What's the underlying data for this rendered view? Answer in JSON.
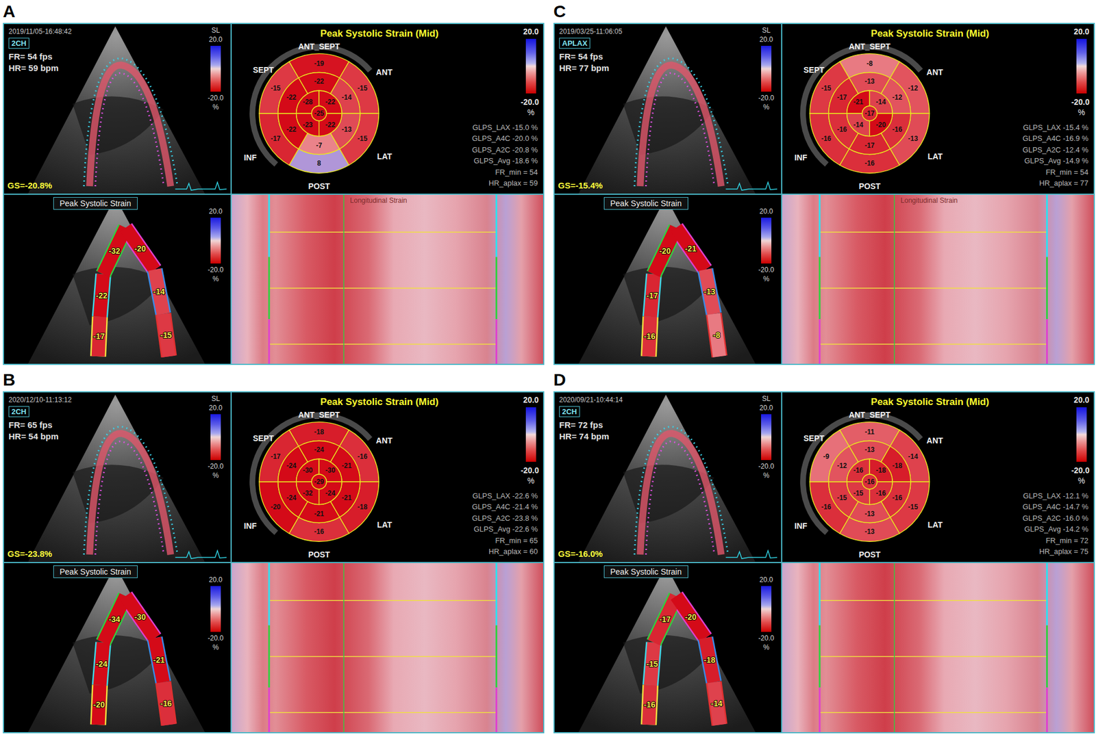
{
  "panels": [
    {
      "letter": "A",
      "echo": {
        "timestamp": "2019/11/05-16:48:42",
        "view": "2CH",
        "fr": "FR= 54 fps",
        "hr": "HR= 59 bpm",
        "scale_label": "SL",
        "scale_max": "20.0",
        "scale_min": "-20.0",
        "scale_unit": "%",
        "gs": "GS=-20.8%"
      },
      "bullseye": {
        "title": "Peak Systolic Strain (Mid)",
        "labels": {
          "ant_sept": "ANT_SEPT",
          "sept": "SEPT",
          "ant": "ANT",
          "inf": "INF",
          "lat": "LAT",
          "post": "POST"
        },
        "basal": [
          "-19",
          "-15",
          "-15",
          "8",
          "-17",
          "-15"
        ],
        "mid": [
          "-22",
          "-14",
          "-13",
          "-7",
          "-22",
          "-22"
        ],
        "apical": [
          "-28",
          "-22",
          "-22",
          "-23"
        ],
        "apex": "-25",
        "scale_max": "20.0",
        "scale_min": "-20.0",
        "scale_unit": "%",
        "stats": [
          "GLPS_LAX -15.0 %",
          "GLPS_A4C -20.0 %",
          "GLPS_A2C -20.8 %",
          "GLPS_Avg -18.6 %",
          "FR_min = 54",
          "HR_aplax = 59"
        ]
      },
      "segments": {
        "label": "Peak Systolic Strain",
        "scale_max": "20.0",
        "scale_min": "-20.0",
        "scale_unit": "%",
        "values": [
          "-17",
          "-22",
          "-32",
          "-20",
          "-14",
          "-15"
        ]
      },
      "heatmap": {
        "title": "Longitudinal Strain"
      }
    },
    {
      "letter": "C",
      "echo": {
        "timestamp": "2019/03/25-11:06:05",
        "view": "APLAX",
        "fr": "FR= 54 fps",
        "hr": "HR= 77 bpm",
        "scale_label": "SL",
        "scale_max": "20.0",
        "scale_min": "-20.0",
        "scale_unit": "%",
        "gs": "GS=-15.4%"
      },
      "bullseye": {
        "title": "Peak Systolic Strain (Mid)",
        "labels": {
          "ant_sept": "ANT_SEPT",
          "sept": "SEPT",
          "ant": "ANT",
          "inf": "INF",
          "lat": "LAT",
          "post": "POST"
        },
        "basal": [
          "-8",
          "-12",
          "-13",
          "-16",
          "-16",
          "-15"
        ],
        "mid": [
          "-13",
          "-12",
          "-16",
          "-17",
          "-16",
          "-17"
        ],
        "apical": [
          "-21",
          "-14",
          "-20",
          "-14"
        ],
        "apex": "-17",
        "scale_max": "20.0",
        "scale_min": "-20.0",
        "scale_unit": "%",
        "stats": [
          "GLPS_LAX -15.4 %",
          "GLPS_A4C -16.9 %",
          "GLPS_A2C -12.4 %",
          "GLPS_Avg -14.9 %",
          "FR_min = 54",
          "HR_aplax = 77"
        ]
      },
      "segments": {
        "label": "Peak Systolic Strain",
        "scale_max": "20.0",
        "scale_min": "-20.0",
        "scale_unit": "%",
        "values": [
          "-16",
          "-17",
          "-20",
          "-21",
          "-13",
          "-8"
        ]
      },
      "heatmap": {
        "title": "Longitudinal Strain"
      }
    },
    {
      "letter": "B",
      "echo": {
        "timestamp": "2020/12/10-11:13:12",
        "view": "2CH",
        "fr": "FR= 65 fps",
        "hr": "HR= 54 bpm",
        "scale_label": "SL",
        "scale_max": "20.0",
        "scale_min": "-20.0",
        "scale_unit": "%",
        "gs": "GS=-23.8%"
      },
      "bullseye": {
        "title": "Peak Systolic Strain (Mid)",
        "labels": {
          "ant_sept": "ANT_SEPT",
          "sept": "SEPT",
          "ant": "ANT",
          "inf": "INF",
          "lat": "LAT",
          "post": "POST"
        },
        "basal": [
          "-18",
          "-16",
          "-18",
          "-16",
          "-20",
          "-17"
        ],
        "mid": [
          "-24",
          "-21",
          "-21",
          "-21",
          "-24",
          "-24"
        ],
        "apical": [
          "-30",
          "-30",
          "-24",
          "-32"
        ],
        "apex": "-29",
        "scale_max": "20.0",
        "scale_min": "-20.0",
        "scale_unit": "%",
        "stats": [
          "GLPS_LAX -22.6 %",
          "GLPS_A4C -21.4 %",
          "GLPS_A2C -23.8 %",
          "GLPS_Avg -22.6 %",
          "FR_min = 65",
          "HR_aplax = 60"
        ]
      },
      "segments": {
        "label": "Peak Systolic Strain",
        "scale_max": "20.0",
        "scale_min": "-20.0",
        "scale_unit": "%",
        "values": [
          "-20",
          "-24",
          "-34",
          "-30",
          "-21",
          "-16"
        ]
      }
    },
    {
      "letter": "D",
      "echo": {
        "timestamp": "2020/09/21-10:44:14",
        "view": "2CH",
        "fr": "FR= 72 fps",
        "hr": "HR= 74 bpm",
        "scale_label": "SL",
        "scale_max": "20.0",
        "scale_min": "-20.0",
        "scale_unit": "%",
        "gs": "GS=-16.0%"
      },
      "bullseye": {
        "title": "Peak Systolic Strain (Mid)",
        "labels": {
          "ant_sept": "ANT_SEPT",
          "sept": "SEPT",
          "ant": "ANT",
          "inf": "INF",
          "lat": "LAT",
          "post": "POST"
        },
        "basal": [
          "-11",
          "-14",
          "-15",
          "-13",
          "-16",
          "-9"
        ],
        "mid": [
          "-13",
          "-18",
          "-16",
          "-13",
          "-15",
          "-12"
        ],
        "apical": [
          "-16",
          "-18",
          "-16",
          "-15"
        ],
        "apex": "-16",
        "scale_max": "20.0",
        "scale_min": "-20.0",
        "scale_unit": "%",
        "stats": [
          "GLPS_LAX -12.1 %",
          "GLPS_A4C -14.7 %",
          "GLPS_A2C -16.0 %",
          "GLPS_Avg -14.2 %",
          "FR_min = 72",
          "HR_aplax = 75"
        ]
      },
      "segments": {
        "label": "Peak Systolic Strain",
        "scale_max": "20.0",
        "scale_min": "-20.0",
        "scale_unit": "%",
        "values": [
          "-16",
          "-15",
          "-17",
          "-20",
          "-18",
          "-14"
        ]
      }
    }
  ]
}
